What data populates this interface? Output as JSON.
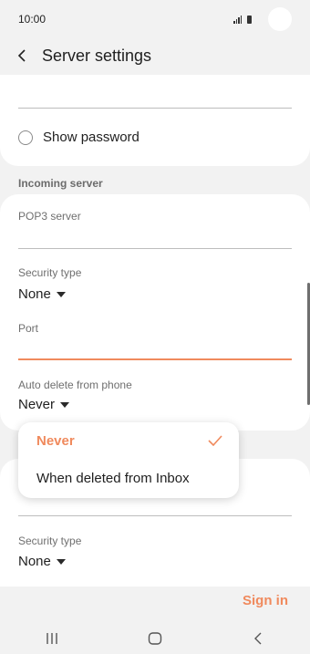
{
  "status_bar": {
    "time": "10:00",
    "signal_icon": "signal-icon",
    "battery_icon": "battery-icon"
  },
  "header": {
    "back_icon": "chevron-left-icon",
    "title": "Server settings"
  },
  "account_section": {
    "show_password_label": "Show password",
    "show_password_checked": false
  },
  "incoming_server": {
    "section_title": "Incoming server",
    "pop3_server_label": "POP3 server",
    "pop3_server_value": "",
    "security_type_label": "Security type",
    "security_type_value": "None",
    "port_label": "Port",
    "port_value": "",
    "auto_delete_label": "Auto delete from phone",
    "auto_delete_value": "Never"
  },
  "auto_delete_dropdown": {
    "options": [
      "Never",
      "When deleted from Inbox"
    ],
    "selected": "Never"
  },
  "outgoing_server": {
    "security_type_label": "Security type",
    "security_type_value": "None"
  },
  "footer": {
    "sign_in_label": "Sign in"
  },
  "nav_bar": {
    "recent_icon": "recent-apps-icon",
    "home_icon": "home-icon",
    "back_icon": "back-icon"
  },
  "colors": {
    "accent": "#f08a5d",
    "background": "#f2f2f2",
    "card": "#ffffff"
  }
}
